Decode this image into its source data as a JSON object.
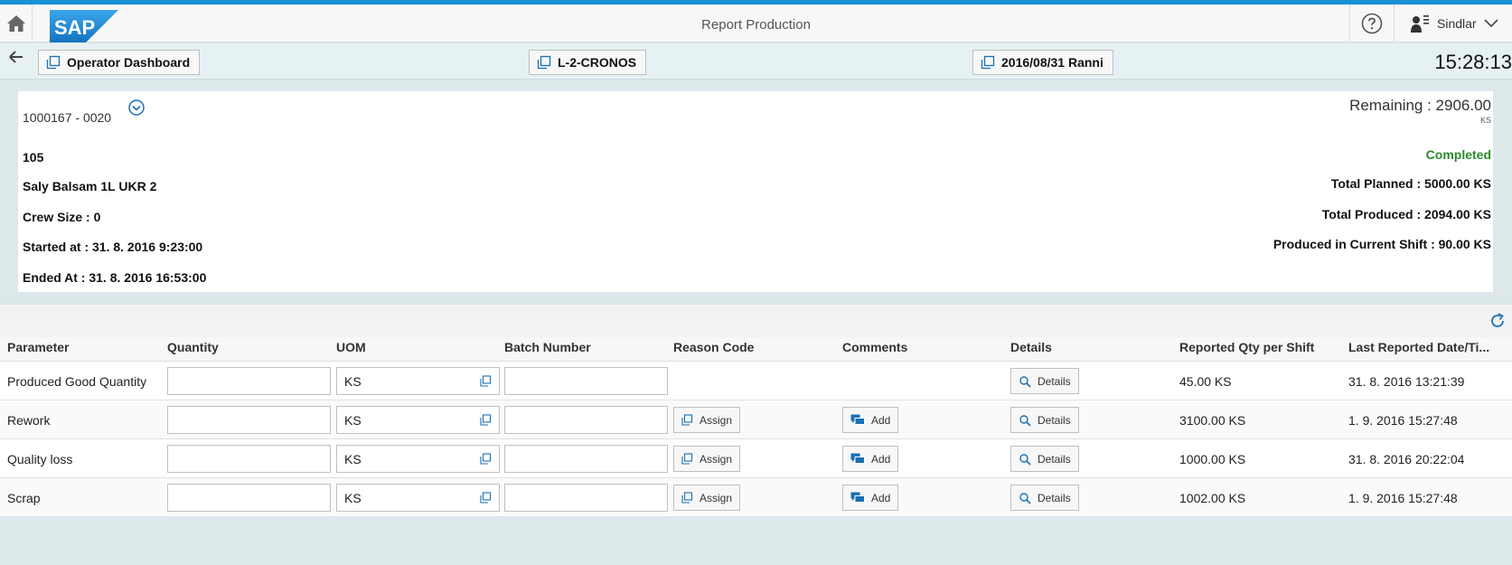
{
  "shell": {
    "title": "Report Production",
    "user_name": "Sindlar",
    "logo_text": "SAP"
  },
  "nav": {
    "operator_dashboard": "Operator Dashboard",
    "resource": "L-2-CRONOS",
    "shift": "2016/08/31 Ranni",
    "clock": "15:28:13"
  },
  "summary": {
    "order_id": "1000167 - 0020",
    "line1": "105",
    "material": "Saly Balsam 1L UKR 2",
    "crew_size": "Crew Size : 0",
    "started_at": "Started at : 31. 8. 2016 9:23:00",
    "ended_at": "Ended At : 31. 8. 2016 16:53:00",
    "remaining": "Remaining : 2906.00",
    "remaining_unit": "KS",
    "status": "Completed",
    "total_planned": "Total Planned : 5000.00 KS",
    "total_produced": "Total Produced : 2094.00 KS",
    "produced_current_shift": "Produced in Current Shift : 90.00 KS"
  },
  "table": {
    "headers": [
      "Parameter",
      "Quantity",
      "UOM",
      "Batch Number",
      "Reason Code",
      "Comments",
      "Details",
      "Reported Qty per Shift",
      "Last Reported Date/Ti..."
    ],
    "rows": [
      {
        "parameter": "Produced Good Quantity",
        "quantity": "",
        "uom": "KS",
        "batch": "",
        "reason_btn": "",
        "comment_btn": "",
        "details_btn": "Details",
        "reported_qty": "45.00 KS",
        "last_reported": "31. 8. 2016 13:21:39"
      },
      {
        "parameter": "Rework",
        "quantity": "",
        "uom": "KS",
        "batch": "",
        "reason_btn": "Assign",
        "comment_btn": "Add",
        "details_btn": "Details",
        "reported_qty": "3100.00 KS",
        "last_reported": "1. 9. 2016 15:27:48"
      },
      {
        "parameter": "Quality loss",
        "quantity": "",
        "uom": "KS",
        "batch": "",
        "reason_btn": "Assign",
        "comment_btn": "Add",
        "details_btn": "Details",
        "reported_qty": "1000.00 KS",
        "last_reported": "31. 8. 2016 20:22:04"
      },
      {
        "parameter": "Scrap",
        "quantity": "",
        "uom": "KS",
        "batch": "",
        "reason_btn": "Assign",
        "comment_btn": "Add",
        "details_btn": "Details",
        "reported_qty": "1002.00 KS",
        "last_reported": "1. 9. 2016 15:27:48"
      }
    ]
  },
  "colors": {
    "accent": "#1b8fd8",
    "status_completed": "#2b8a2b",
    "background": "#dde8ea"
  }
}
